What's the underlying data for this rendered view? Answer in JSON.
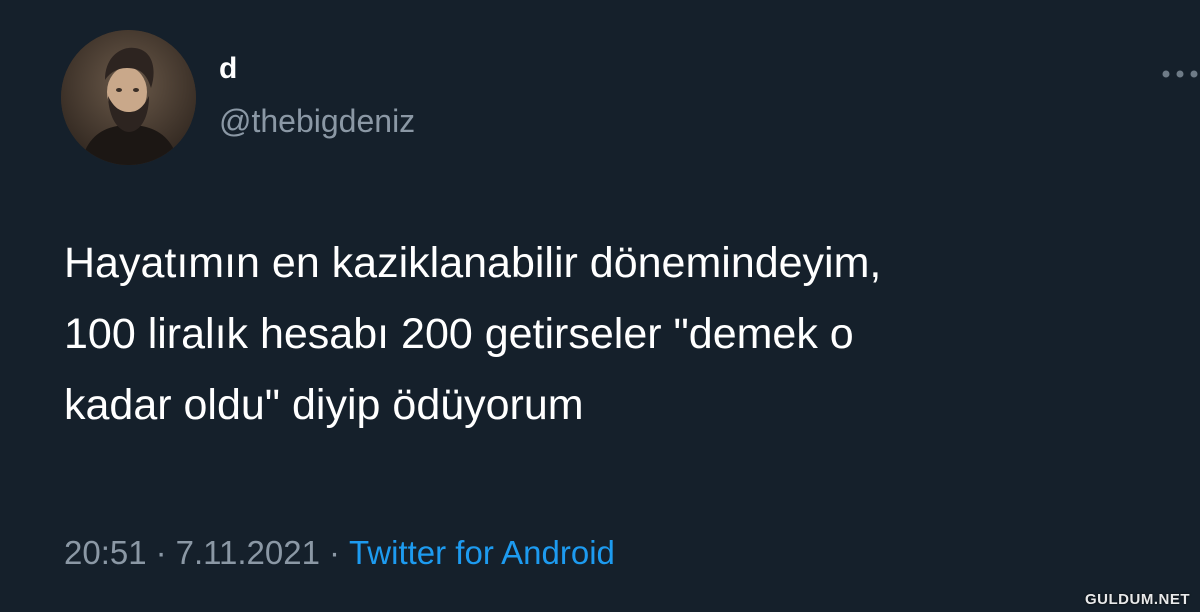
{
  "author": {
    "display_name": "d",
    "handle": "@thebigdeniz",
    "avatar_icon": "bearded-man-portrait"
  },
  "tweet": {
    "text_lines": [
      "Hayatımın en kaziklanabilir dönemindeyim,",
      "100 liralık hesabı 200 getirseler \"demek o",
      "kadar oldu\" diyip ödüyorum"
    ]
  },
  "meta": {
    "time": "20:51",
    "separator": "·",
    "date": "7.11.2021",
    "source": "Twitter for Android"
  },
  "watermark": "GULDUM.NET",
  "colors": {
    "background": "#15202b",
    "text": "#ffffff",
    "muted": "#8b98a5",
    "link": "#1d9bf0"
  }
}
